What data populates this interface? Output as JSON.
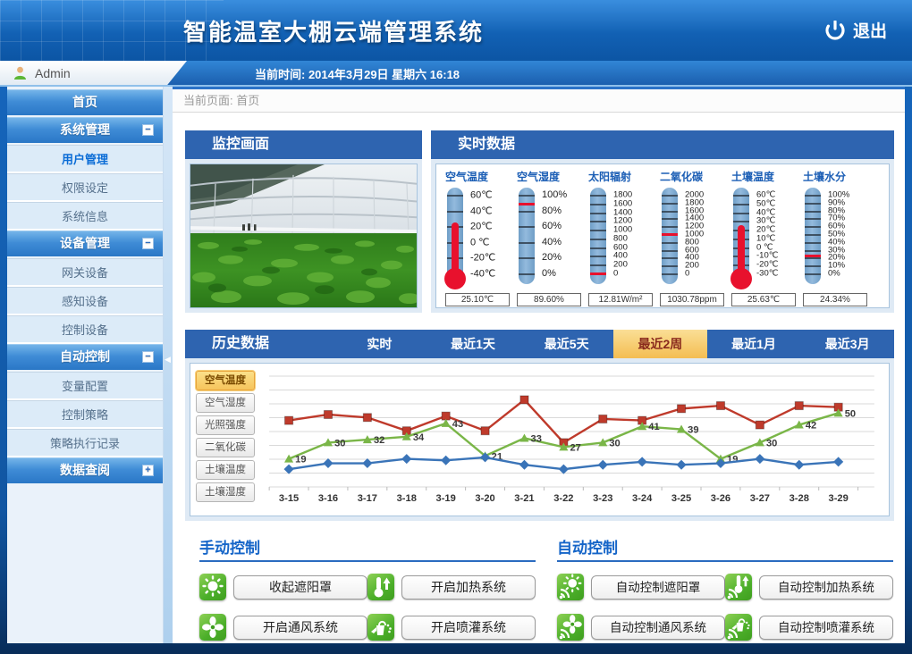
{
  "header": {
    "title": "智能温室大棚云端管理系统",
    "logout_label": "退出"
  },
  "admin_bar": {
    "username": "Admin",
    "time_label": "当前时间: 2014年3月29日 星期六 16:18"
  },
  "sidebar": {
    "items": [
      {
        "label": "首页",
        "type": "home"
      },
      {
        "label": "系统管理",
        "type": "group",
        "expand": "minus"
      },
      {
        "label": "用户管理",
        "type": "sub",
        "active": true
      },
      {
        "label": "权限设定",
        "type": "sub"
      },
      {
        "label": "系统信息",
        "type": "sub"
      },
      {
        "label": "设备管理",
        "type": "group",
        "expand": "minus"
      },
      {
        "label": "网关设备",
        "type": "sub"
      },
      {
        "label": "感知设备",
        "type": "sub"
      },
      {
        "label": "控制设备",
        "type": "sub"
      },
      {
        "label": "自动控制",
        "type": "group",
        "expand": "minus"
      },
      {
        "label": "变量配置",
        "type": "sub"
      },
      {
        "label": "控制策略",
        "type": "sub"
      },
      {
        "label": "策略执行记录",
        "type": "sub"
      },
      {
        "label": "数据查阅",
        "type": "group",
        "expand": "plus"
      }
    ]
  },
  "breadcrumb": {
    "label": "当前页面: 首页"
  },
  "monitor_panel": {
    "title": "监控画面"
  },
  "realtime_panel": {
    "title": "实时数据",
    "gauges": [
      {
        "name": "空气温度",
        "style": "thermometer",
        "ticks": [
          "60℃",
          "40℃",
          "20℃",
          "0 ℃",
          "-20℃",
          "-40℃"
        ],
        "value_text": "25.10℃",
        "fraction": 0.651
      },
      {
        "name": "空气湿度",
        "style": "tube",
        "ticks": [
          "100%",
          "80%",
          "60%",
          "40%",
          "20%",
          "0%"
        ],
        "value_text": "89.60%",
        "fraction": 0.896
      },
      {
        "name": "太阳辐射",
        "style": "tube",
        "ticks": [
          "1800",
          "1600",
          "1400",
          "1200",
          "1000",
          "800",
          "600",
          "400",
          "200",
          "0"
        ],
        "value_text": "12.81W/m²",
        "fraction": 0.01
      },
      {
        "name": "二氧化碳",
        "style": "tube",
        "ticks": [
          "2000",
          "1800",
          "1600",
          "1400",
          "1200",
          "1000",
          "800",
          "600",
          "400",
          "200",
          "0"
        ],
        "value_text": "1030.78ppm",
        "fraction": 0.515
      },
      {
        "name": "土壤温度",
        "style": "thermometer",
        "ticks": [
          "60℃",
          "50℃",
          "40℃",
          "30℃",
          "20℃",
          "10℃",
          "0 ℃",
          "-10℃",
          "-20℃",
          "-30℃"
        ],
        "value_text": "25.63℃",
        "fraction": 0.618
      },
      {
        "name": "土壤水分",
        "style": "tube",
        "ticks": [
          "100%",
          "90%",
          "80%",
          "70%",
          "60%",
          "50%",
          "40%",
          "30%",
          "20%",
          "10%",
          "0%"
        ],
        "value_text": "24.34%",
        "fraction": 0.243
      }
    ]
  },
  "history_panel": {
    "title": "历史数据",
    "tabs": [
      {
        "label": "实时"
      },
      {
        "label": "最近1天"
      },
      {
        "label": "最近5天"
      },
      {
        "label": "最近2周",
        "active": true
      },
      {
        "label": "最近1月"
      },
      {
        "label": "最近3月"
      }
    ],
    "metric_buttons": [
      {
        "label": "空气温度",
        "active": true
      },
      {
        "label": "空气湿度"
      },
      {
        "label": "光照强度"
      },
      {
        "label": "二氧化碳"
      },
      {
        "label": "土壤温度"
      },
      {
        "label": "土壤湿度"
      }
    ]
  },
  "chart_data": {
    "type": "line",
    "x": [
      "3-15",
      "3-16",
      "3-17",
      "3-18",
      "3-19",
      "3-20",
      "3-21",
      "3-22",
      "3-23",
      "3-24",
      "3-25",
      "3-26",
      "3-27",
      "3-28",
      "3-29"
    ],
    "series": [
      {
        "name": "red-squares",
        "marker": "square",
        "color": "#bf3a2b",
        "values": [
          45,
          49,
          47,
          38,
          48,
          38,
          59,
          30,
          46,
          45,
          53,
          55,
          42,
          55,
          54
        ]
      },
      {
        "name": "green-triangles",
        "marker": "triangle",
        "color": "#7ab648",
        "values": [
          19,
          30,
          32,
          34,
          43,
          21,
          33,
          27,
          30,
          41,
          39,
          19,
          30,
          42,
          50
        ],
        "labels_visible": true
      },
      {
        "name": "blue-diamonds",
        "marker": "diamond",
        "color": "#3a74b8",
        "values": [
          12,
          16,
          16,
          19,
          18,
          20,
          15,
          12,
          15,
          17,
          15,
          16,
          19,
          15,
          17
        ]
      }
    ],
    "ylim": [
      0,
      75
    ],
    "grid": true,
    "legend_position": "left-buttons"
  },
  "manual_control": {
    "title": "手动控制",
    "buttons": [
      {
        "label": "收起遮阳罩",
        "icon": "sun-icon"
      },
      {
        "label": "开启加热系统",
        "icon": "thermometer-icon"
      },
      {
        "label": "开启通风系统",
        "icon": "fan-icon"
      },
      {
        "label": "开启喷灌系统",
        "icon": "sprinkler-icon"
      }
    ]
  },
  "auto_control": {
    "title": "自动控制",
    "buttons": [
      {
        "label": "自动控制遮阳罩",
        "icon": "sun-wifi-icon"
      },
      {
        "label": "自动控制加热系统",
        "icon": "thermometer-wifi-icon"
      },
      {
        "label": "自动控制通风系统",
        "icon": "fan-wifi-icon"
      },
      {
        "label": "自动控制喷灌系统",
        "icon": "sprinkler-wifi-icon"
      }
    ]
  },
  "colors": {
    "panel_header": "#2e64b0",
    "tab_active": "#f4bd52",
    "gauge_red": "#e8112d",
    "sidebar_active_text": "#0a6cd6",
    "section_title": "#1565c8",
    "control_green": "#4caf2a"
  }
}
